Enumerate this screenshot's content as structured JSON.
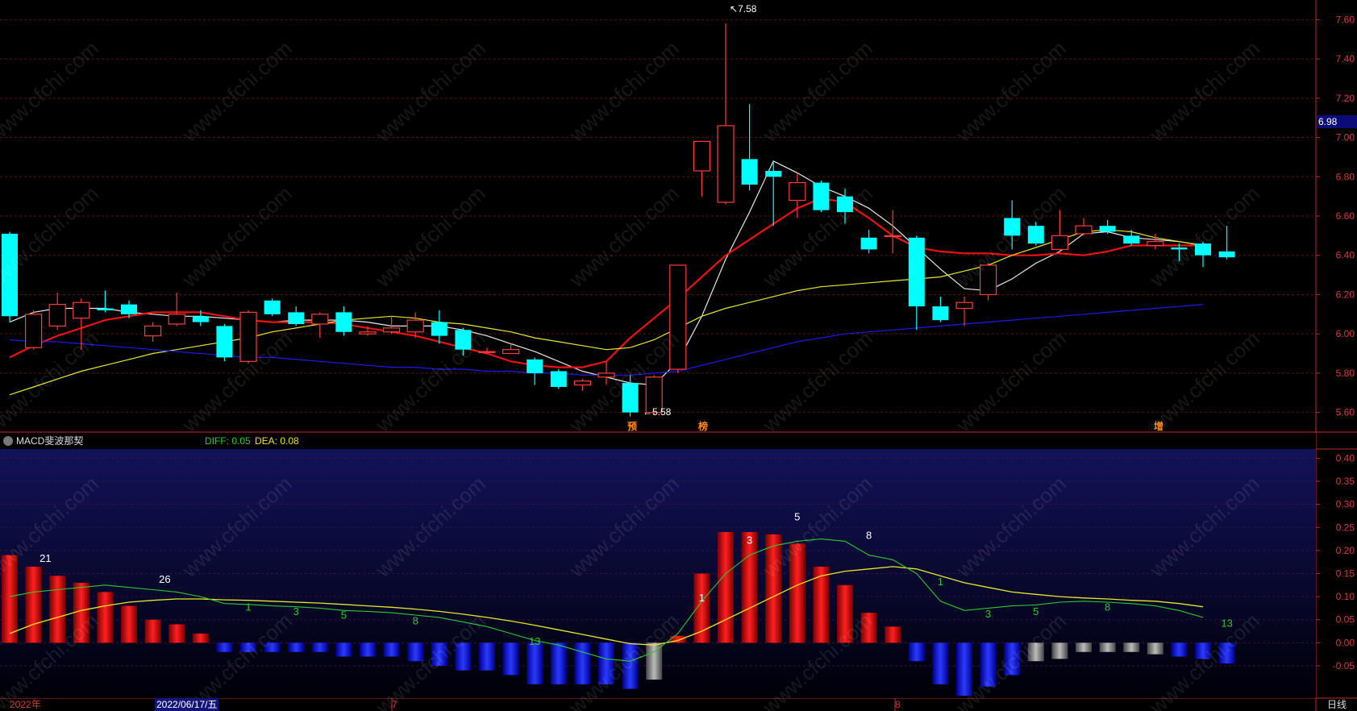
{
  "chart_data": [
    {
      "type": "candlestick",
      "ylim": [
        5.5,
        7.7
      ],
      "y_ticks": [
        "7.60",
        "7.40",
        "7.20",
        "7.00",
        "6.80",
        "6.60",
        "6.40",
        "6.20",
        "6.00",
        "5.80",
        "5.60"
      ],
      "current_price": "6.98",
      "high_label": "7.58",
      "low_label": "5.58",
      "markers": [
        "预",
        "榜",
        "增"
      ],
      "candles": [
        {
          "o": 6.51,
          "c": 6.09,
          "h": 6.52,
          "l": 6.06
        },
        {
          "o": 5.93,
          "c": 6.1,
          "h": 6.12,
          "l": 5.92
        },
        {
          "o": 6.04,
          "c": 6.15,
          "h": 6.21,
          "l": 6.02
        },
        {
          "o": 6.08,
          "c": 6.16,
          "h": 6.18,
          "l": 5.92
        },
        {
          "o": 6.13,
          "c": 6.12,
          "h": 6.22,
          "l": 6.11
        },
        {
          "o": 6.15,
          "c": 6.1,
          "h": 6.17,
          "l": 6.08
        },
        {
          "o": 5.99,
          "c": 6.04,
          "h": 6.06,
          "l": 5.96
        },
        {
          "o": 6.05,
          "c": 6.1,
          "h": 6.21,
          "l": 6.04
        },
        {
          "o": 6.09,
          "c": 6.06,
          "h": 6.12,
          "l": 6.04
        },
        {
          "o": 6.04,
          "c": 5.88,
          "h": 6.05,
          "l": 5.86
        },
        {
          "o": 5.86,
          "c": 6.11,
          "h": 6.12,
          "l": 5.85
        },
        {
          "o": 6.17,
          "c": 6.1,
          "h": 6.18,
          "l": 6.09
        },
        {
          "o": 6.11,
          "c": 6.05,
          "h": 6.14,
          "l": 6.04
        },
        {
          "o": 6.05,
          "c": 6.1,
          "h": 6.11,
          "l": 5.98
        },
        {
          "o": 6.11,
          "c": 6.01,
          "h": 6.14,
          "l": 5.99
        },
        {
          "o": 6.0,
          "c": 6.01,
          "h": 6.04,
          "l": 5.99
        },
        {
          "o": 6.01,
          "c": 6.03,
          "h": 6.09,
          "l": 6.0
        },
        {
          "o": 6.01,
          "c": 6.07,
          "h": 6.11,
          "l": 5.98
        },
        {
          "o": 6.06,
          "c": 5.99,
          "h": 6.12,
          "l": 5.95
        },
        {
          "o": 6.02,
          "c": 5.92,
          "h": 6.03,
          "l": 5.89
        },
        {
          "o": 5.91,
          "c": 5.91,
          "h": 5.93,
          "l": 5.9
        },
        {
          "o": 5.9,
          "c": 5.92,
          "h": 5.95,
          "l": 5.9
        },
        {
          "o": 5.87,
          "c": 5.8,
          "h": 5.88,
          "l": 5.74
        },
        {
          "o": 5.81,
          "c": 5.73,
          "h": 5.82,
          "l": 5.72
        },
        {
          "o": 5.74,
          "c": 5.76,
          "h": 5.77,
          "l": 5.71
        },
        {
          "o": 5.78,
          "c": 5.8,
          "h": 5.86,
          "l": 5.74
        },
        {
          "o": 5.75,
          "c": 5.6,
          "h": 5.79,
          "l": 5.58
        },
        {
          "o": 5.6,
          "c": 5.78,
          "h": 5.79,
          "l": 5.59
        },
        {
          "o": 5.82,
          "c": 6.35,
          "h": 6.35,
          "l": 5.8
        },
        {
          "o": 6.83,
          "c": 6.98,
          "h": 6.98,
          "l": 6.7
        },
        {
          "o": 6.67,
          "c": 7.06,
          "h": 7.58,
          "l": 6.66
        },
        {
          "o": 6.89,
          "c": 6.76,
          "h": 7.17,
          "l": 6.73
        },
        {
          "o": 6.83,
          "c": 6.8,
          "h": 6.88,
          "l": 6.55
        },
        {
          "o": 6.68,
          "c": 6.77,
          "h": 6.82,
          "l": 6.59
        },
        {
          "o": 6.77,
          "c": 6.63,
          "h": 6.78,
          "l": 6.62
        },
        {
          "o": 6.7,
          "c": 6.62,
          "h": 6.74,
          "l": 6.56
        },
        {
          "o": 6.49,
          "c": 6.43,
          "h": 6.53,
          "l": 6.41
        },
        {
          "o": 6.5,
          "c": 6.5,
          "h": 6.63,
          "l": 6.41
        },
        {
          "o": 6.49,
          "c": 6.14,
          "h": 6.5,
          "l": 6.02
        },
        {
          "o": 6.14,
          "c": 6.07,
          "h": 6.19,
          "l": 6.06
        },
        {
          "o": 6.13,
          "c": 6.16,
          "h": 6.19,
          "l": 6.04
        },
        {
          "o": 6.2,
          "c": 6.35,
          "h": 6.36,
          "l": 6.17
        },
        {
          "o": 6.59,
          "c": 6.5,
          "h": 6.68,
          "l": 6.43
        },
        {
          "o": 6.55,
          "c": 6.46,
          "h": 6.57,
          "l": 6.45
        },
        {
          "o": 6.43,
          "c": 6.5,
          "h": 6.63,
          "l": 6.41
        },
        {
          "o": 6.51,
          "c": 6.55,
          "h": 6.59,
          "l": 6.5
        },
        {
          "o": 6.55,
          "c": 6.52,
          "h": 6.58,
          "l": 6.51
        },
        {
          "o": 6.5,
          "c": 6.46,
          "h": 6.53,
          "l": 6.45
        },
        {
          "o": 6.45,
          "c": 6.47,
          "h": 6.51,
          "l": 6.43
        },
        {
          "o": 6.44,
          "c": 6.43,
          "h": 6.46,
          "l": 6.37
        },
        {
          "o": 6.46,
          "c": 6.4,
          "h": 6.47,
          "l": 6.34
        },
        {
          "o": 6.42,
          "c": 6.39,
          "h": 6.55,
          "l": 6.38
        }
      ],
      "ma": [
        {
          "name": "ma5",
          "color": "#e8e8e8",
          "start": 0,
          "values": [
            6.06,
            6.11,
            6.13,
            6.13,
            6.13,
            6.11,
            6.1,
            6.09,
            6.09,
            6.08,
            6.07,
            6.06,
            6.07,
            6.07,
            6.07,
            6.06,
            6.04,
            6.04,
            6.04,
            6.02,
            5.99,
            5.95,
            5.91,
            5.86,
            5.81,
            5.78,
            5.75,
            5.74,
            5.86,
            6.09,
            6.38,
            6.62,
            6.88,
            6.82,
            6.75,
            6.7,
            6.64,
            6.55,
            6.44,
            6.33,
            6.23,
            6.22,
            6.28,
            6.36,
            6.42,
            6.51,
            6.52,
            6.49,
            6.48,
            6.47,
            6.45
          ]
        },
        {
          "name": "ma10",
          "color": "#ee1111",
          "start": 0,
          "values": [
            5.88,
            5.94,
            5.99,
            6.03,
            6.07,
            6.09,
            6.11,
            6.11,
            6.11,
            6.09,
            6.07,
            6.06,
            6.06,
            6.06,
            6.05,
            6.03,
            6.01,
            5.99,
            5.96,
            5.93,
            5.9,
            5.86,
            5.84,
            5.83,
            5.83,
            5.86,
            5.98,
            6.08,
            6.18,
            6.29,
            6.4,
            6.48,
            6.56,
            6.64,
            6.69,
            6.67,
            6.59,
            6.5,
            6.44,
            6.42,
            6.41,
            6.41,
            6.4,
            6.4,
            6.41,
            6.4,
            6.42,
            6.45,
            6.45,
            6.45,
            6.45
          ]
        },
        {
          "name": "ma20",
          "color": "#e6e62a",
          "start": 0,
          "values": [
            5.69,
            5.73,
            5.77,
            5.81,
            5.84,
            5.87,
            5.9,
            5.92,
            5.94,
            5.96,
            5.98,
            6.01,
            6.03,
            6.05,
            6.07,
            6.08,
            6.09,
            6.08,
            6.06,
            6.05,
            6.03,
            6.01,
            5.98,
            5.96,
            5.94,
            5.92,
            5.93,
            5.97,
            6.03,
            6.09,
            6.13,
            6.16,
            6.19,
            6.22,
            6.24,
            6.25,
            6.26,
            6.27,
            6.28,
            6.29,
            6.32,
            6.35,
            6.4,
            6.44,
            6.48,
            6.52,
            6.53,
            6.52,
            6.49,
            6.47,
            6.45
          ]
        },
        {
          "name": "ma60",
          "color": "#1a1aee",
          "start": 0,
          "values": [
            5.97,
            5.96,
            5.96,
            5.95,
            5.94,
            5.93,
            5.92,
            5.91,
            5.9,
            5.89,
            5.88,
            5.88,
            5.87,
            5.86,
            5.85,
            5.84,
            5.83,
            5.83,
            5.82,
            5.82,
            5.81,
            5.81,
            5.8,
            5.8,
            5.79,
            5.79,
            5.79,
            5.8,
            5.81,
            5.84,
            5.87,
            5.9,
            5.93,
            5.96,
            5.98,
            6.0,
            6.01,
            6.02,
            6.03,
            6.04,
            6.05,
            6.06,
            6.07,
            6.08,
            6.09,
            6.1,
            6.11,
            6.12,
            6.13,
            6.14,
            6.15
          ]
        }
      ]
    },
    {
      "type": "bar",
      "title": "MACD斐波那契",
      "diff_label": "DIFF: 0.05",
      "dea_label": "DEA: 0.08",
      "ylim": [
        -0.12,
        0.42
      ],
      "y_ticks": [
        "0.40",
        "0.35",
        "0.30",
        "0.25",
        "0.20",
        "0.15",
        "0.10",
        "0.05",
        "0.00",
        "-0.05"
      ],
      "histogram": [
        0.19,
        0.165,
        0.145,
        0.13,
        0.11,
        0.08,
        0.05,
        0.04,
        0.02,
        -0.02,
        -0.02,
        -0.02,
        -0.02,
        -0.02,
        -0.03,
        -0.03,
        -0.03,
        -0.04,
        -0.05,
        -0.06,
        -0.06,
        -0.07,
        -0.09,
        -0.09,
        -0.09,
        -0.09,
        -0.1,
        -0.08,
        0.015,
        0.15,
        0.24,
        0.24,
        0.235,
        0.215,
        0.165,
        0.125,
        0.065,
        0.035,
        -0.04,
        -0.09,
        -0.115,
        -0.095,
        -0.07,
        -0.04,
        -0.035,
        -0.02,
        -0.02,
        -0.02,
        -0.025,
        -0.03,
        -0.035,
        -0.045
      ],
      "hist_gray_indices": [
        27,
        43,
        44,
        45,
        46,
        47,
        48
      ],
      "diff": [
        0.1,
        0.11,
        0.115,
        0.12,
        0.125,
        0.12,
        0.115,
        0.11,
        0.1,
        0.085,
        0.083,
        0.08,
        0.078,
        0.075,
        0.07,
        0.068,
        0.065,
        0.06,
        0.055,
        0.045,
        0.035,
        0.02,
        0.005,
        -0.005,
        -0.02,
        -0.035,
        -0.04,
        -0.02,
        0.02,
        0.09,
        0.15,
        0.19,
        0.21,
        0.22,
        0.225,
        0.22,
        0.19,
        0.18,
        0.15,
        0.09,
        0.07,
        0.075,
        0.08,
        0.082,
        0.088,
        0.09,
        0.088,
        0.085,
        0.08,
        0.07,
        0.055
      ],
      "dea": [
        0.02,
        0.04,
        0.055,
        0.07,
        0.08,
        0.088,
        0.092,
        0.095,
        0.095,
        0.093,
        0.092,
        0.09,
        0.088,
        0.086,
        0.083,
        0.08,
        0.077,
        0.073,
        0.068,
        0.062,
        0.055,
        0.047,
        0.038,
        0.028,
        0.018,
        0.008,
        -0.002,
        -0.005,
        0.005,
        0.025,
        0.05,
        0.075,
        0.1,
        0.125,
        0.145,
        0.155,
        0.16,
        0.165,
        0.16,
        0.145,
        0.13,
        0.12,
        0.11,
        0.105,
        0.1,
        0.097,
        0.095,
        0.092,
        0.09,
        0.085,
        0.078
      ],
      "annotations": [
        {
          "label": "21",
          "color": "#ffffff",
          "i": 1.5,
          "v": 0.175
        },
        {
          "label": "26",
          "color": "#ffffff",
          "i": 6.5,
          "v": 0.13
        },
        {
          "label": "1",
          "color": "#2ec92e",
          "i": 10,
          "v": 0.07
        },
        {
          "label": "3",
          "color": "#2ec92e",
          "i": 12,
          "v": 0.06
        },
        {
          "label": "5",
          "color": "#2ec92e",
          "i": 14,
          "v": 0.052
        },
        {
          "label": "8",
          "color": "#2ec92e",
          "i": 17,
          "v": 0.04
        },
        {
          "label": "13",
          "color": "#2ec92e",
          "i": 22,
          "v": -0.005
        },
        {
          "label": "1",
          "color": "#ffffff",
          "i": 29,
          "v": 0.09
        },
        {
          "label": "3",
          "color": "#ffffff",
          "i": 31,
          "v": 0.215
        },
        {
          "label": "5",
          "color": "#ffffff",
          "i": 33,
          "v": 0.265
        },
        {
          "label": "8",
          "color": "#ffffff",
          "i": 36,
          "v": 0.225
        },
        {
          "label": "1",
          "color": "#2ec92e",
          "i": 39,
          "v": 0.125
        },
        {
          "label": "3",
          "color": "#2ec92e",
          "i": 41,
          "v": 0.055
        },
        {
          "label": "5",
          "color": "#2ec92e",
          "i": 43,
          "v": 0.06
        },
        {
          "label": "8",
          "color": "#2ec92e",
          "i": 46,
          "v": 0.07
        },
        {
          "label": "13",
          "color": "#2ec92e",
          "i": 51,
          "v": 0.035
        }
      ]
    }
  ],
  "xaxis": {
    "year": "2022年",
    "date_selected": "2022/06/17/五",
    "month_7": "7",
    "month_8": "8",
    "period": "日线"
  },
  "watermark": "www.cfchi.com",
  "colors": {
    "up": "#ff3a3a",
    "down": "#00ffff",
    "grid": "#5a0f0f",
    "axis": "#c42a2a"
  }
}
